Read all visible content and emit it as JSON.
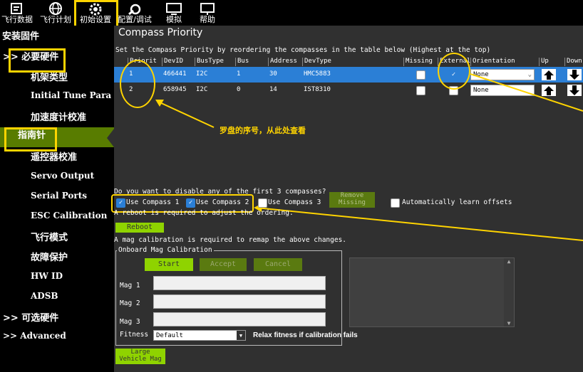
{
  "toolbar": {
    "items": [
      {
        "label": "飞行数据"
      },
      {
        "label": "飞行计划"
      },
      {
        "label": "初始设置"
      },
      {
        "label": "配置/调试"
      },
      {
        "label": "模拟"
      },
      {
        "label": "帮助"
      }
    ]
  },
  "sidebar": {
    "items": [
      {
        "label": "安装固件"
      },
      {
        "label": ">> 必要硬件"
      },
      {
        "label": "机架类型"
      },
      {
        "label": "Initial Tune Para"
      },
      {
        "label": "加速度计校准"
      },
      {
        "label": "指南针"
      },
      {
        "label": "遥控器校准"
      },
      {
        "label": "Servo Output"
      },
      {
        "label": "Serial Ports"
      },
      {
        "label": "ESC Calibration"
      },
      {
        "label": "飞行模式"
      },
      {
        "label": "故障保护"
      },
      {
        "label": "HW ID"
      },
      {
        "label": "ADSB"
      },
      {
        "label": ">> 可选硬件"
      },
      {
        "label": ">> Advanced"
      }
    ]
  },
  "compass": {
    "title": "Compass Priority",
    "instruction": "Set the Compass Priority by reordering the compasses in the table below (Highest at the top)",
    "headers": [
      "Priorit",
      "DevID",
      "BusType",
      "Bus",
      "Address",
      "DevType",
      "Missing",
      "External",
      "Orientation",
      "Up",
      "Down"
    ],
    "rows": [
      {
        "priority": "1",
        "devid": "466441",
        "bustype": "I2C",
        "bus": "1",
        "address": "30",
        "devtype": "HMC5883",
        "external": true,
        "orientation": "None"
      },
      {
        "priority": "2",
        "devid": "658945",
        "bustype": "I2C",
        "bus": "0",
        "address": "14",
        "devtype": "IST8310",
        "external": false,
        "orientation": "None"
      }
    ],
    "annotation": "罗盘的序号，从此处查看",
    "disable_question": "Do you want to disable any of the first 3 compasses?",
    "use1": "Use Compass 1",
    "use2": "Use Compass 2",
    "use3": "Use Compass 3",
    "remove_missing": "Remove Missing",
    "auto_learn": "Automatically learn offsets",
    "reboot_note": "A reboot is required to adjust the ordering.",
    "reboot_btn": "Reboot",
    "mag_note": "A mag calibration is required to remap the above changes.",
    "onboard_title": "Onboard Mag Calibration",
    "start": "Start",
    "accept": "Accept",
    "cancel": "Cancel",
    "mag1": "Mag 1",
    "mag2": "Mag 2",
    "mag3": "Mag 3",
    "fitness_label": "Fitness",
    "fitness_value": "Default",
    "relax": "Relax fitness if calibration fails",
    "large_vehicle": "Large Vehicle Mag"
  }
}
